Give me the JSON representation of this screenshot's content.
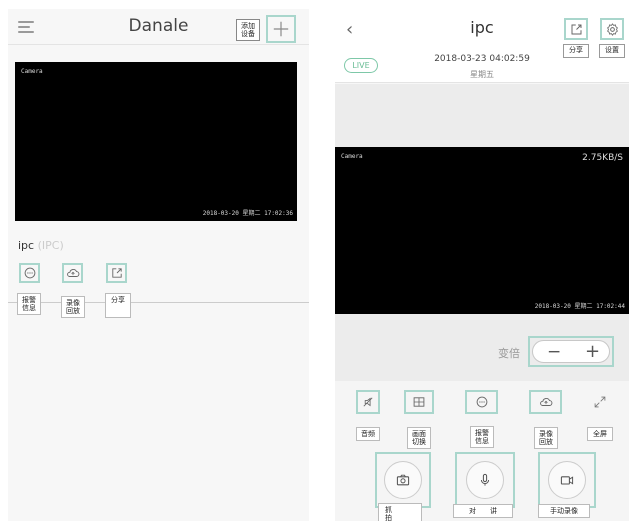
{
  "left": {
    "title": "Danale",
    "add_device_label": "添加\n设备",
    "camera_label": "Camera",
    "timestamp": "2018-03-20 星期二 17:02:36",
    "device_name": "ipc",
    "device_type": "(IPC)",
    "actions": [
      {
        "icon": "message-icon",
        "label": "报警\n信息"
      },
      {
        "icon": "cloud-icon",
        "label": "录像\n回放"
      },
      {
        "icon": "share-icon",
        "label": "分享"
      }
    ]
  },
  "right": {
    "title": "ipc",
    "share_label": "分享",
    "settings_label": "设置",
    "live_badge": "LIVE",
    "datetime": "2018-03-23 04:02:59",
    "weekday": "星期五",
    "camera_label": "Camera",
    "data_rate": "2.75KB/S",
    "timestamp": "2018-03-20 星期二 17:02:44",
    "zoom_label": "变倍",
    "controls": [
      {
        "icon": "mute-icon",
        "label": "音频"
      },
      {
        "icon": "grid-icon",
        "label": "画面\n切换"
      },
      {
        "icon": "message-icon",
        "label": "报警\n信息"
      },
      {
        "icon": "cloud-icon",
        "label": "录像\n回放"
      },
      {
        "icon": "fullscreen-icon",
        "label": "全屏"
      }
    ],
    "big_buttons": [
      {
        "icon": "camera-icon",
        "label": "抓\n拍"
      },
      {
        "icon": "microphone-icon",
        "label": "对　　讲"
      },
      {
        "icon": "video-record-icon",
        "label": "手动录像"
      }
    ]
  },
  "colors": {
    "accent_border": "#a9d6cc",
    "live_green": "#6bbd96"
  }
}
